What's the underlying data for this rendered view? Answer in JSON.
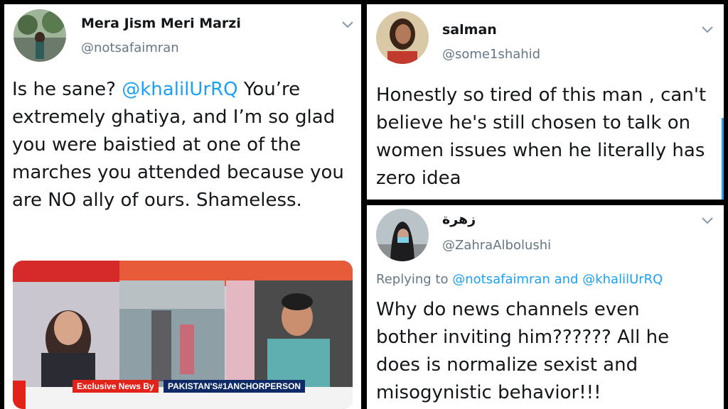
{
  "tweet1": {
    "display_name": "Mera Jism Meri Marzi",
    "handle": "@notsafaimran",
    "text_before": "Is he sane? ",
    "mention": "@khalilUrRQ",
    "text_after": " You’re extremely ghatiya, and I’m so glad you were baistied at one of the marches you attended because you are NO ally of ours. Shameless.",
    "media": {
      "ticker_left": "Exclusive News By",
      "ticker_right": "PAKISTAN'S#1ANCHORPERSON"
    }
  },
  "tweet2": {
    "display_name": "salman",
    "handle": "@some1shahid",
    "text": "Honestly so tired of this man , can't believe he's still chosen to talk on women issues when he literally has zero idea"
  },
  "tweet3": {
    "display_name": "زهرة",
    "handle": "@ZahraAlbolushi",
    "replying_prefix": "Replying to",
    "replying_to_1": "@notsafaimran",
    "replying_and": "and",
    "replying_to_2": "@khalilUrRQ",
    "text": "Why do news channels even bother inviting him?????? All he does is normalize sexist and misogynistic behavior!!!"
  },
  "colors": {
    "link": "#1da1f2",
    "secondary_text": "#657786",
    "primary_text": "#14171a",
    "ticker_red": "#e2231a",
    "ticker_navy": "#0d2a66"
  },
  "icons": [
    "chevron-down-icon",
    "avatar"
  ]
}
